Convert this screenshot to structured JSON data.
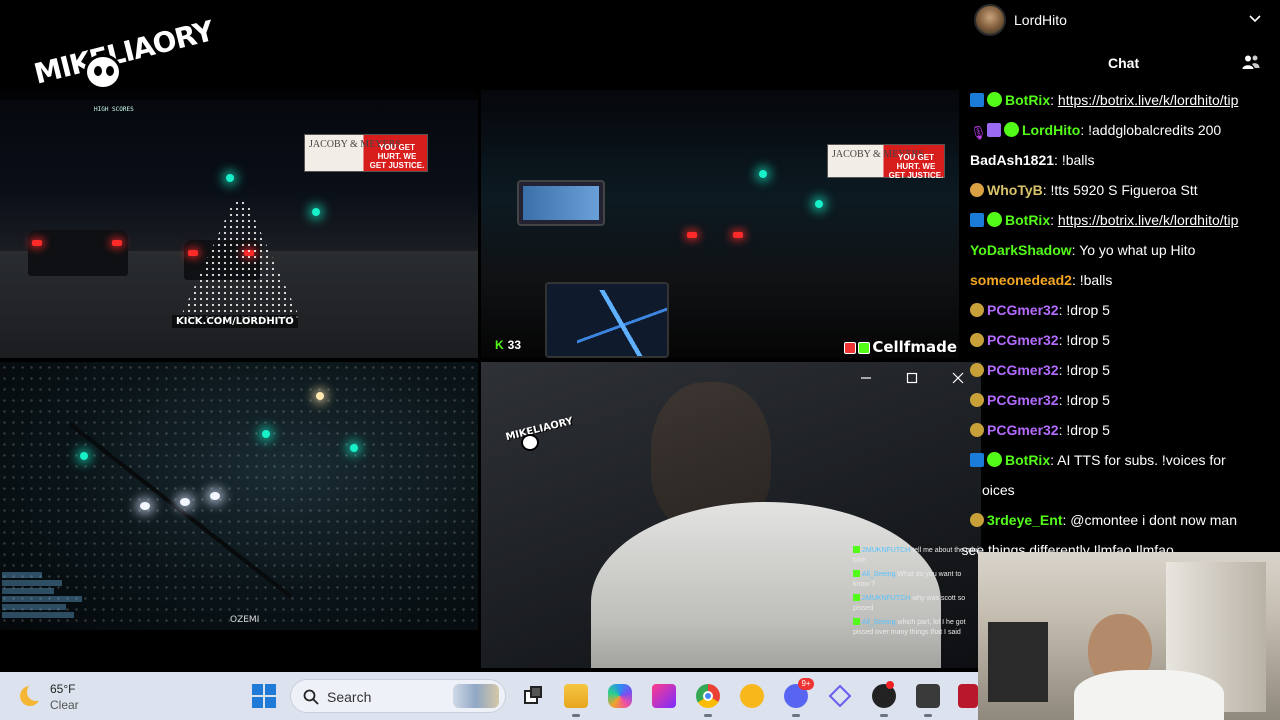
{
  "stream": {
    "logo_text": "MIKELIAORY",
    "kick_url": "KICK.COM/LORDHITO",
    "viewer_count": "33",
    "watermark_name": "Cellfmade",
    "bottom_watermark": "OZEMI"
  },
  "profile": {
    "username": "LordHito"
  },
  "chat": {
    "title": "Chat",
    "messages": [
      {
        "user": "BotRix",
        "text": "https://botrix.live/k/lordhito/tip",
        "color": "#53fc18",
        "badges": [
          "bot",
          "verified"
        ],
        "link": true
      },
      {
        "user": "LordHito",
        "text": "!addglobalcredits 200",
        "color": "#53fc18",
        "badges": [
          "mic",
          "gift",
          "verified"
        ]
      },
      {
        "user": "BadAsh1821",
        "text": "!balls",
        "color": "#ffffff",
        "badges": []
      },
      {
        "user": "WhoTyB",
        "text": "!tts 5920 S Figueroa Stt",
        "color": "#d8c26a",
        "badges": [
          "cookie"
        ]
      },
      {
        "user": "BotRix",
        "text": "https://botrix.live/k/lordhito/tip",
        "color": "#53fc18",
        "badges": [
          "bot",
          "verified"
        ],
        "link": true
      },
      {
        "user": "YoDarkShadow",
        "text": "Yo yo what up Hito",
        "color": "#53fc18",
        "badges": []
      },
      {
        "user": "someonedead2",
        "text": "!balls",
        "color": "#f5a623",
        "badges": []
      },
      {
        "user": "PCGmer32",
        "text": "!drop 5",
        "color": "#b36bff",
        "badges": [
          "badge"
        ]
      },
      {
        "user": "PCGmer32",
        "text": "!drop 5",
        "color": "#b36bff",
        "badges": [
          "badge"
        ]
      },
      {
        "user": "PCGmer32",
        "text": "!drop 5",
        "color": "#b36bff",
        "badges": [
          "badge"
        ]
      },
      {
        "user": "PCGmer32",
        "text": "!drop 5",
        "color": "#b36bff",
        "badges": [
          "badge"
        ]
      },
      {
        "user": "PCGmer32",
        "text": "!drop 5",
        "color": "#b36bff",
        "badges": [
          "badge"
        ]
      },
      {
        "user": "BotRix",
        "text": "AI TTS for subs. !voices for",
        "color": "#53fc18",
        "badges": [
          "bot",
          "verified"
        ]
      },
      {
        "user": "",
        "text": "oices",
        "color": "#ffffff",
        "badges": []
      },
      {
        "user": "3rdeye_Ent",
        "text": "@cmontee i dont now man",
        "color": "#53fc18",
        "badges": [
          "badge"
        ]
      },
      {
        "user": "",
        "text": "rs see things differently !lmfao !lmfao",
        "color": "#ffffff",
        "badges": []
      }
    ]
  },
  "video_chat": [
    {
      "user": "2MUKNFUTCH",
      "text": "tell me about the mini bike"
    },
    {
      "user": "All_Seeing",
      "text": "What do you want to know ?"
    },
    {
      "user": "2MUKNFUTCH",
      "text": "why was scott so pissed"
    },
    {
      "user": "All_Seeing",
      "text": "which part, lol I he got pissed over many things that I said"
    }
  ],
  "billboards": {
    "firm": "JACOBY & MEYERS",
    "slogan": "YOU GET HURT. WE GET JUSTICE."
  },
  "taskbar": {
    "temperature": "65°F",
    "condition": "Clear",
    "search_placeholder": "Search"
  },
  "colors": {
    "kick_green": "#53fc18",
    "taskbar_bg": "#dce3ee",
    "chat_bg": "#000000"
  }
}
